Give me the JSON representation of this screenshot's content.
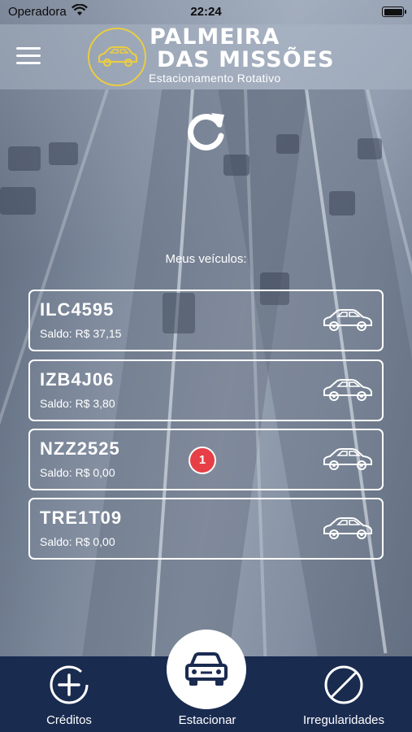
{
  "status_bar": {
    "carrier": "Operadora",
    "time": "22:24"
  },
  "header": {
    "brand_line1": "PALMEIRA",
    "brand_line2": "DAS MISSÕES",
    "subtitle": "Estacionamento Rotativo",
    "logo_color": "#e8cc45"
  },
  "main": {
    "vehicles_title": "Meus veículos:",
    "vehicles": [
      {
        "plate": "ILC4595",
        "balance": "Saldo: R$ 37,15"
      },
      {
        "plate": "IZB4J06",
        "balance": "Saldo: R$ 3,80"
      },
      {
        "plate": "NZZ2525",
        "balance": "Saldo: R$ 0,00",
        "badge": "1"
      },
      {
        "plate": "TRE1T09",
        "balance": "Saldo: R$ 0,00"
      }
    ],
    "badge_color": "#e63f47"
  },
  "tabbar": {
    "background": "#1a2b50",
    "credits_label": "Créditos",
    "park_label": "Estacionar",
    "irregularities_label": "Irregularidades"
  }
}
